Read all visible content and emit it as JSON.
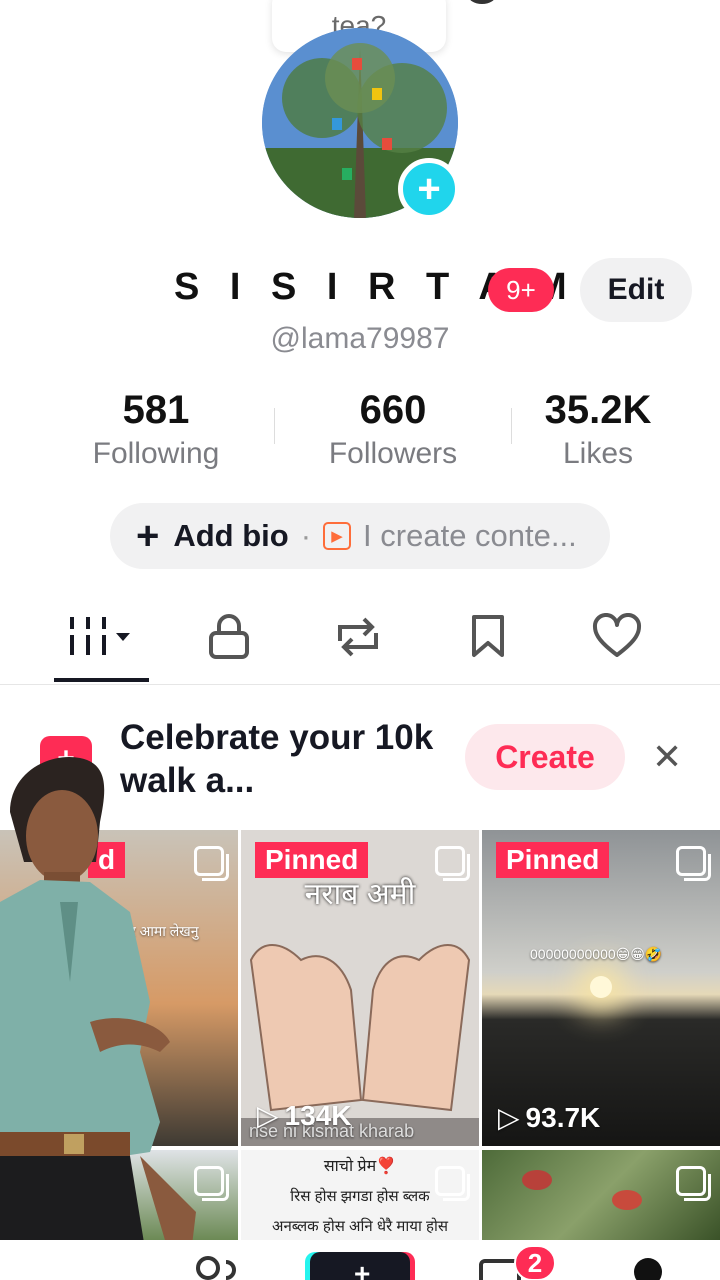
{
  "story": {
    "bubble_text": "tea?"
  },
  "profile": {
    "name": "S I S I R T A M ...",
    "notification_badge": "9+",
    "edit_label": "Edit",
    "handle": "@lama79987"
  },
  "stats": [
    {
      "value": "581",
      "label": "Following"
    },
    {
      "value": "660",
      "label": "Followers"
    },
    {
      "value": "35.2K",
      "label": "Likes"
    }
  ],
  "bio": {
    "add_label": "Add bio",
    "dot": "·",
    "link_text": "I create conte..."
  },
  "tabs": [
    "videos-grid",
    "private",
    "reposts",
    "favorites",
    "liked"
  ],
  "promo": {
    "text": "Celebrate your 10k walk a...",
    "create_label": "Create"
  },
  "grid": [
    {
      "pinned": "d",
      "caption": "र आमा लेखनु",
      "views": ""
    },
    {
      "pinned": "Pinned",
      "caption": "नराब  अमी",
      "caption2": "nse ni kismat kharab",
      "views": "134K"
    },
    {
      "pinned": "Pinned",
      "caption": "00000000000😁😁🤣",
      "views": "93.7K"
    },
    {
      "caption": ""
    },
    {
      "caption": "साचो प्रेम❣️",
      "caption2": "रिस होस झगडा होस ब्लक",
      "caption3": "अनब्लक होस अनि धेरै माया होस"
    },
    {
      "caption": ""
    }
  ],
  "nav": {
    "inbox_badge": "2"
  },
  "colors": {
    "accent": "#fe2c55",
    "avatar_add": "#20d5ec"
  }
}
